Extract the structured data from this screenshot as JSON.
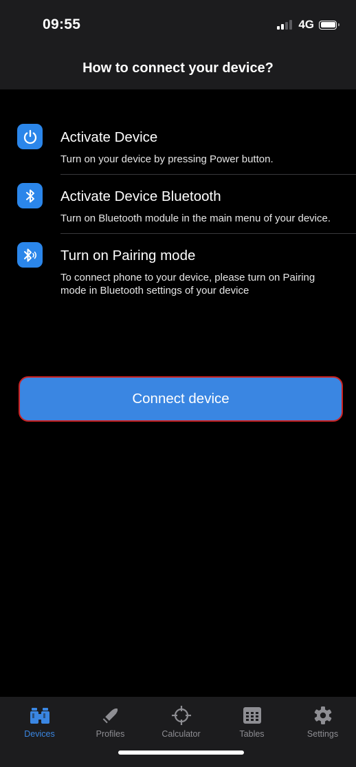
{
  "status_bar": {
    "time": "09:55",
    "network": "4G"
  },
  "header": {
    "title": "How to connect your device?"
  },
  "steps": [
    {
      "icon": "power-icon",
      "title": "Activate Device",
      "description": "Turn on your device by pressing Power button."
    },
    {
      "icon": "bluetooth-icon",
      "title": "Activate Device Bluetooth",
      "description": "Turn on Bluetooth module in the main menu of your device."
    },
    {
      "icon": "bluetooth-pairing-icon",
      "title": "Turn on Pairing mode",
      "description": "To connect phone to your device, please turn on Pairing mode in Bluetooth settings of your device"
    }
  ],
  "connect_button": {
    "label": "Connect device"
  },
  "tabbar": {
    "tabs": [
      {
        "label": "Devices",
        "icon": "binoculars-icon",
        "active": true
      },
      {
        "label": "Profiles",
        "icon": "bullet-icon",
        "active": false
      },
      {
        "label": "Calculator",
        "icon": "crosshair-icon",
        "active": false
      },
      {
        "label": "Tables",
        "icon": "table-grid-icon",
        "active": false
      },
      {
        "label": "Settings",
        "icon": "gear-icon",
        "active": false
      }
    ]
  },
  "colors": {
    "accent": "#3a86e2",
    "icon_background": "#2b86ea",
    "background": "#000000",
    "bar_background": "#1c1c1e",
    "inactive_tab": "#8e8e93",
    "button_outline": "#cc2222"
  }
}
